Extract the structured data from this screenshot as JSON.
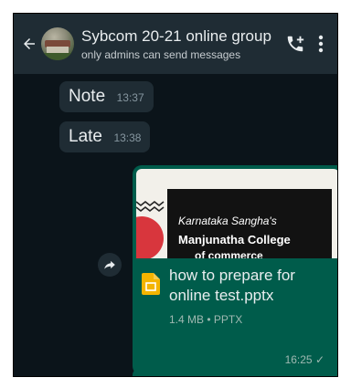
{
  "header": {
    "title": "Sybcom 20-21 online group",
    "subtitle": "only admins can send messages"
  },
  "messages_in": [
    {
      "text": "Note",
      "time": "13:37"
    },
    {
      "text": "Late",
      "time": "13:38"
    }
  ],
  "attachment": {
    "preview_line1": "Karnataka Sangha's",
    "preview_line2": "Manjunatha College",
    "preview_line3": "of commerce",
    "file_name": "how to prepare for online test.pptx",
    "file_meta": "1.4 MB • PPTX",
    "time": "16:25 ✓"
  },
  "colors": {
    "chat_bg": "#0b141a",
    "header_bg": "#1f2c34",
    "incoming_bubble": "#1f2c34",
    "outgoing_bubble": "#005c4b",
    "file_icon": "#f4b400"
  },
  "icons": {
    "back": "arrow-left-icon",
    "call": "add-call-icon",
    "menu": "more-vert-icon",
    "forward": "forward-icon",
    "file": "google-slides-file-icon"
  }
}
